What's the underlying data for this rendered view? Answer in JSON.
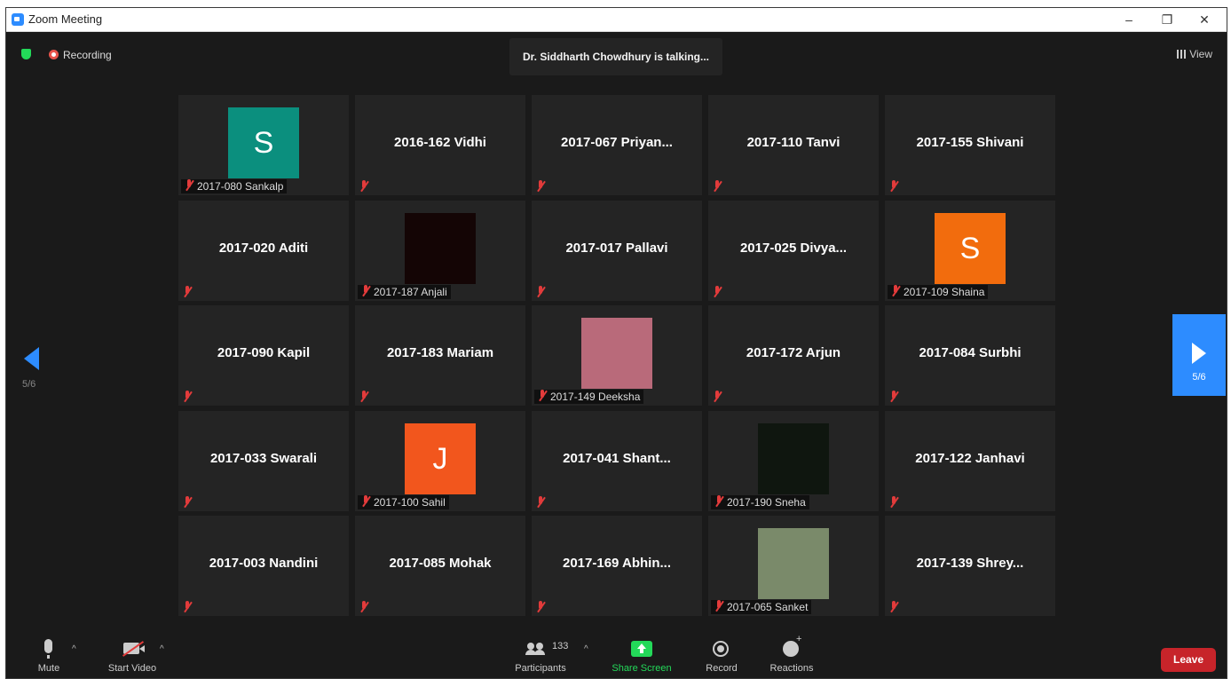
{
  "window": {
    "title": "Zoom Meeting",
    "minimize": "–",
    "restore": "❐",
    "close": "✕"
  },
  "status": {
    "recording_label": "Recording",
    "talking": "Dr. Siddharth Chowdhury is talking...",
    "view_label": "View"
  },
  "pager": {
    "left_page": "5/6",
    "right_page": "5/6"
  },
  "colors": {
    "accent": "#2d8cff",
    "leave": "#c7242a",
    "muted": "#e23b3b",
    "share": "#23d959"
  },
  "tiles": [
    {
      "name": "2017-080 Sankalp",
      "type": "avatar",
      "initial": "S",
      "color": "#0b8f7e"
    },
    {
      "name": "2016-162 Vidhi",
      "type": "name"
    },
    {
      "name": "2017-067  Priyan...",
      "type": "name"
    },
    {
      "name": "2017-110 Tanvi",
      "type": "name"
    },
    {
      "name": "2017-155 Shivani",
      "type": "name"
    },
    {
      "name": "2017-020 Aditi",
      "type": "name"
    },
    {
      "name": "2017-187 Anjali",
      "type": "video",
      "color": "#140505"
    },
    {
      "name": "2017-017 Pallavi",
      "type": "name"
    },
    {
      "name": "2017-025  Divya...",
      "type": "name"
    },
    {
      "name": "2017-109 Shaina",
      "type": "avatar",
      "initial": "S",
      "color": "#f26c0d"
    },
    {
      "name": "2017-090 Kapil",
      "type": "name"
    },
    {
      "name": "2017-183 Mariam",
      "type": "name"
    },
    {
      "name": "2017-149 Deeksha",
      "type": "photo",
      "color": "#b96a7a"
    },
    {
      "name": "2017-172 Arjun",
      "type": "name"
    },
    {
      "name": "2017-084 Surbhi",
      "type": "name"
    },
    {
      "name": "2017-033 Swarali",
      "type": "name"
    },
    {
      "name": "2017-100 Sahil",
      "type": "avatar",
      "initial": "J",
      "color": "#f2561d"
    },
    {
      "name": "2017-041  Shant...",
      "type": "name"
    },
    {
      "name": "2017-190 Sneha",
      "type": "video",
      "color": "#0f160f"
    },
    {
      "name": "2017-122 Janhavi",
      "type": "name"
    },
    {
      "name": "2017-003 Nandini",
      "type": "name"
    },
    {
      "name": "2017-085 Mohak",
      "type": "name"
    },
    {
      "name": "2017-169  Abhin...",
      "type": "name"
    },
    {
      "name": "2017-065 Sanket",
      "type": "photo",
      "color": "#7a8a6a"
    },
    {
      "name": "2017-139  Shrey...",
      "type": "name"
    }
  ],
  "toolbar": {
    "mute": "Mute",
    "start_video": "Start Video",
    "participants": "Participants",
    "participant_count": "133",
    "share_screen": "Share Screen",
    "record": "Record",
    "reactions": "Reactions",
    "leave": "Leave",
    "caret": "^"
  }
}
